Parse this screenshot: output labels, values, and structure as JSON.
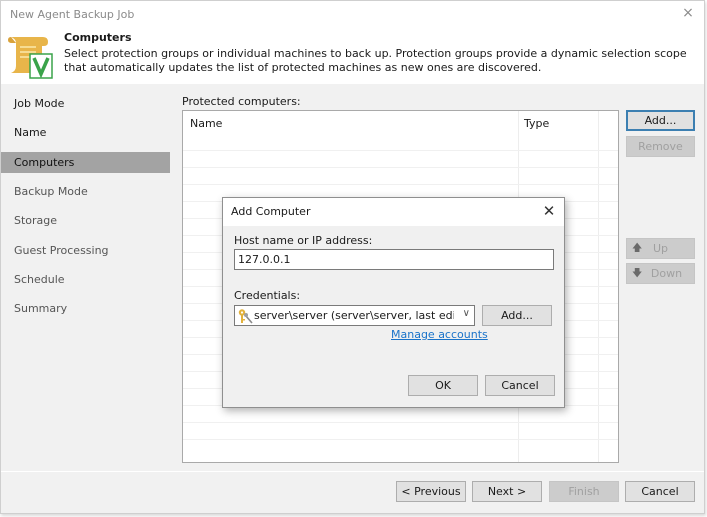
{
  "window": {
    "title": "New Agent Backup Job",
    "close_icon": "×"
  },
  "header": {
    "title": "Computers",
    "description": "Select protection groups or individual machines to back up. Protection groups provide a dynamic selection scope that automatically updates the list of protected machines as new ones are discovered."
  },
  "sidebar": {
    "items": [
      {
        "label": "Job Mode",
        "state": "done"
      },
      {
        "label": "Name",
        "state": "done"
      },
      {
        "label": "Computers",
        "state": "active"
      },
      {
        "label": "Backup Mode",
        "state": "pending"
      },
      {
        "label": "Storage",
        "state": "pending"
      },
      {
        "label": "Guest Processing",
        "state": "pending"
      },
      {
        "label": "Schedule",
        "state": "pending"
      },
      {
        "label": "Summary",
        "state": "pending"
      }
    ]
  },
  "main": {
    "list_label": "Protected computers:",
    "columns": [
      "Name",
      "Type"
    ],
    "rows": [],
    "buttons": {
      "add": "Add...",
      "remove": "Remove",
      "up": "Up",
      "down": "Down"
    }
  },
  "footer": {
    "previous": "< Previous",
    "next": "Next >",
    "finish": "Finish",
    "cancel": "Cancel"
  },
  "dialog": {
    "title": "Add Computer",
    "host_label": "Host name or IP address:",
    "host_value": "127.0.0.1",
    "credentials_label": "Credentials:",
    "credentials_value": "server\\server (server\\server, last edited: less than a day ago)",
    "add_credentials": "Add...",
    "manage_accounts": "Manage accounts",
    "ok": "OK",
    "cancel": "Cancel"
  },
  "colors": {
    "accent_border": "#3c7fb1",
    "link": "#1a73c9",
    "sidebar_active": "#a3a3a3",
    "icon_scroll": "#e8b54a",
    "icon_check": "#3aa34a"
  }
}
